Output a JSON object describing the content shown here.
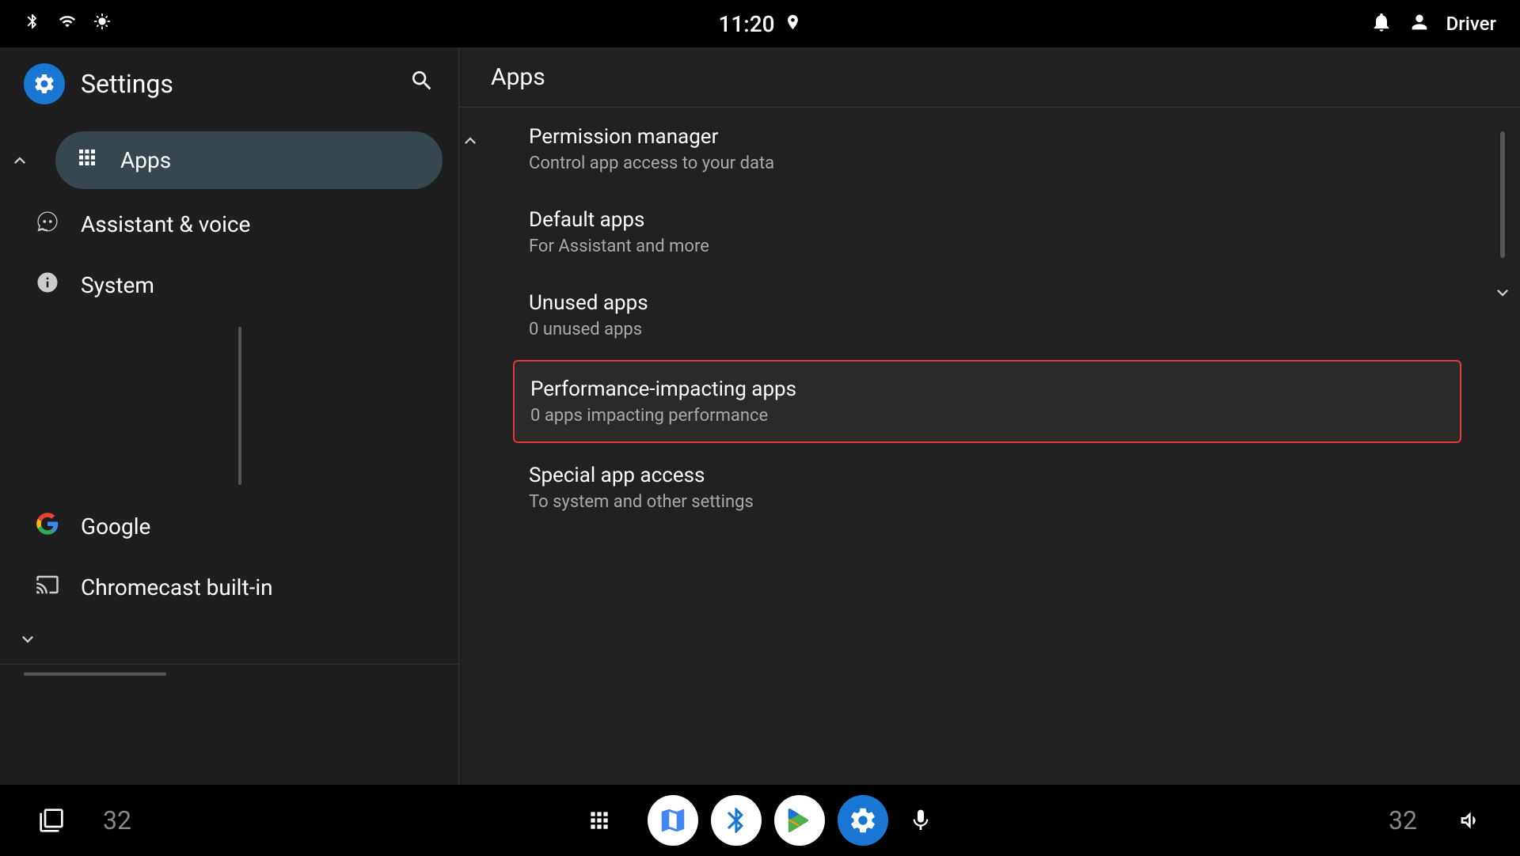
{
  "statusBar": {
    "time": "11:20",
    "rightLabel": "Driver",
    "icons": {
      "bluetooth": "bluetooth",
      "wifi": "wifi",
      "brightness": "brightness",
      "location": "location",
      "bell": "bell",
      "person": "person"
    }
  },
  "leftPanel": {
    "title": "Settings",
    "searchIcon": "search",
    "navItems": [
      {
        "id": "apps",
        "label": "Apps",
        "icon": "grid",
        "active": true
      },
      {
        "id": "assistant",
        "label": "Assistant & voice",
        "icon": "assistant"
      },
      {
        "id": "system",
        "label": "System",
        "icon": "info-circle"
      },
      {
        "id": "google",
        "label": "Google",
        "icon": "google"
      },
      {
        "id": "chromecast",
        "label": "Chromecast built-in",
        "icon": "cast"
      }
    ],
    "collapseUpLabel": "collapse-up",
    "collapseDownLabel": "collapse-down"
  },
  "rightPanel": {
    "title": "Apps",
    "menuItems": [
      {
        "id": "permission-manager",
        "title": "Permission manager",
        "subtitle": "Control app access to your data",
        "selected": false
      },
      {
        "id": "default-apps",
        "title": "Default apps",
        "subtitle": "For Assistant and more",
        "selected": false
      },
      {
        "id": "unused-apps",
        "title": "Unused apps",
        "subtitle": "0 unused apps",
        "selected": false
      },
      {
        "id": "performance-apps",
        "title": "Performance-impacting apps",
        "subtitle": "0 apps impacting performance",
        "selected": true
      },
      {
        "id": "special-app-access",
        "title": "Special app access",
        "subtitle": "To system and other settings",
        "selected": false
      }
    ]
  },
  "taskbar": {
    "leftCount": "32",
    "rightCount": "32",
    "apps": [
      {
        "id": "maps",
        "label": "Maps"
      },
      {
        "id": "bluetooth",
        "label": "Bluetooth"
      },
      {
        "id": "play",
        "label": "Play Store"
      },
      {
        "id": "settings",
        "label": "Settings"
      }
    ]
  }
}
